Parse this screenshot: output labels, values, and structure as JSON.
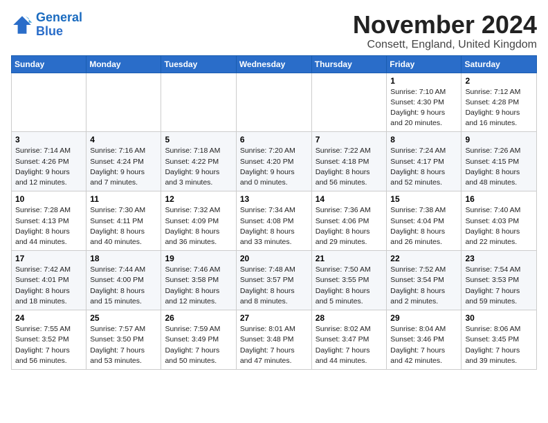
{
  "logo": {
    "line1": "General",
    "line2": "Blue"
  },
  "title": "November 2024",
  "location": "Consett, England, United Kingdom",
  "days_header": [
    "Sunday",
    "Monday",
    "Tuesday",
    "Wednesday",
    "Thursday",
    "Friday",
    "Saturday"
  ],
  "weeks": [
    [
      {
        "day": "",
        "info": ""
      },
      {
        "day": "",
        "info": ""
      },
      {
        "day": "",
        "info": ""
      },
      {
        "day": "",
        "info": ""
      },
      {
        "day": "",
        "info": ""
      },
      {
        "day": "1",
        "info": "Sunrise: 7:10 AM\nSunset: 4:30 PM\nDaylight: 9 hours\nand 20 minutes."
      },
      {
        "day": "2",
        "info": "Sunrise: 7:12 AM\nSunset: 4:28 PM\nDaylight: 9 hours\nand 16 minutes."
      }
    ],
    [
      {
        "day": "3",
        "info": "Sunrise: 7:14 AM\nSunset: 4:26 PM\nDaylight: 9 hours\nand 12 minutes."
      },
      {
        "day": "4",
        "info": "Sunrise: 7:16 AM\nSunset: 4:24 PM\nDaylight: 9 hours\nand 7 minutes."
      },
      {
        "day": "5",
        "info": "Sunrise: 7:18 AM\nSunset: 4:22 PM\nDaylight: 9 hours\nand 3 minutes."
      },
      {
        "day": "6",
        "info": "Sunrise: 7:20 AM\nSunset: 4:20 PM\nDaylight: 9 hours\nand 0 minutes."
      },
      {
        "day": "7",
        "info": "Sunrise: 7:22 AM\nSunset: 4:18 PM\nDaylight: 8 hours\nand 56 minutes."
      },
      {
        "day": "8",
        "info": "Sunrise: 7:24 AM\nSunset: 4:17 PM\nDaylight: 8 hours\nand 52 minutes."
      },
      {
        "day": "9",
        "info": "Sunrise: 7:26 AM\nSunset: 4:15 PM\nDaylight: 8 hours\nand 48 minutes."
      }
    ],
    [
      {
        "day": "10",
        "info": "Sunrise: 7:28 AM\nSunset: 4:13 PM\nDaylight: 8 hours\nand 44 minutes."
      },
      {
        "day": "11",
        "info": "Sunrise: 7:30 AM\nSunset: 4:11 PM\nDaylight: 8 hours\nand 40 minutes."
      },
      {
        "day": "12",
        "info": "Sunrise: 7:32 AM\nSunset: 4:09 PM\nDaylight: 8 hours\nand 36 minutes."
      },
      {
        "day": "13",
        "info": "Sunrise: 7:34 AM\nSunset: 4:08 PM\nDaylight: 8 hours\nand 33 minutes."
      },
      {
        "day": "14",
        "info": "Sunrise: 7:36 AM\nSunset: 4:06 PM\nDaylight: 8 hours\nand 29 minutes."
      },
      {
        "day": "15",
        "info": "Sunrise: 7:38 AM\nSunset: 4:04 PM\nDaylight: 8 hours\nand 26 minutes."
      },
      {
        "day": "16",
        "info": "Sunrise: 7:40 AM\nSunset: 4:03 PM\nDaylight: 8 hours\nand 22 minutes."
      }
    ],
    [
      {
        "day": "17",
        "info": "Sunrise: 7:42 AM\nSunset: 4:01 PM\nDaylight: 8 hours\nand 18 minutes."
      },
      {
        "day": "18",
        "info": "Sunrise: 7:44 AM\nSunset: 4:00 PM\nDaylight: 8 hours\nand 15 minutes."
      },
      {
        "day": "19",
        "info": "Sunrise: 7:46 AM\nSunset: 3:58 PM\nDaylight: 8 hours\nand 12 minutes."
      },
      {
        "day": "20",
        "info": "Sunrise: 7:48 AM\nSunset: 3:57 PM\nDaylight: 8 hours\nand 8 minutes."
      },
      {
        "day": "21",
        "info": "Sunrise: 7:50 AM\nSunset: 3:55 PM\nDaylight: 8 hours\nand 5 minutes."
      },
      {
        "day": "22",
        "info": "Sunrise: 7:52 AM\nSunset: 3:54 PM\nDaylight: 8 hours\nand 2 minutes."
      },
      {
        "day": "23",
        "info": "Sunrise: 7:54 AM\nSunset: 3:53 PM\nDaylight: 7 hours\nand 59 minutes."
      }
    ],
    [
      {
        "day": "24",
        "info": "Sunrise: 7:55 AM\nSunset: 3:52 PM\nDaylight: 7 hours\nand 56 minutes."
      },
      {
        "day": "25",
        "info": "Sunrise: 7:57 AM\nSunset: 3:50 PM\nDaylight: 7 hours\nand 53 minutes."
      },
      {
        "day": "26",
        "info": "Sunrise: 7:59 AM\nSunset: 3:49 PM\nDaylight: 7 hours\nand 50 minutes."
      },
      {
        "day": "27",
        "info": "Sunrise: 8:01 AM\nSunset: 3:48 PM\nDaylight: 7 hours\nand 47 minutes."
      },
      {
        "day": "28",
        "info": "Sunrise: 8:02 AM\nSunset: 3:47 PM\nDaylight: 7 hours\nand 44 minutes."
      },
      {
        "day": "29",
        "info": "Sunrise: 8:04 AM\nSunset: 3:46 PM\nDaylight: 7 hours\nand 42 minutes."
      },
      {
        "day": "30",
        "info": "Sunrise: 8:06 AM\nSunset: 3:45 PM\nDaylight: 7 hours\nand 39 minutes."
      }
    ]
  ]
}
